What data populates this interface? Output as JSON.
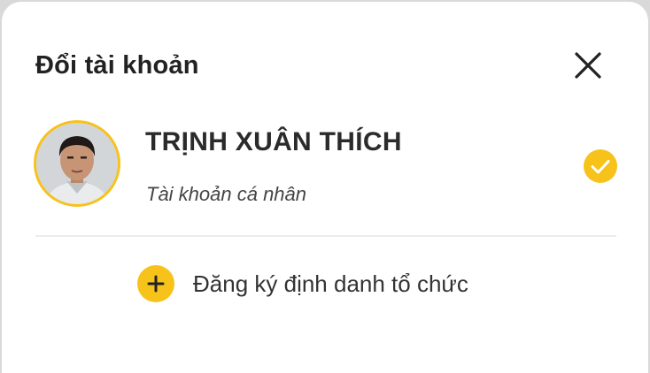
{
  "dialog": {
    "title": "Đổi tài khoản",
    "close_icon": "close-icon"
  },
  "account": {
    "name": "TRỊNH XUÂN THÍCH",
    "type": "Tài khoản cá nhân",
    "selected": true,
    "selected_icon": "check-circle-icon"
  },
  "actions": {
    "register_label": "Đăng ký định danh tổ chức",
    "register_icon": "plus-circle-icon"
  },
  "colors": {
    "accent": "#f7c21a",
    "text": "#222222",
    "background": "#ffffff"
  }
}
